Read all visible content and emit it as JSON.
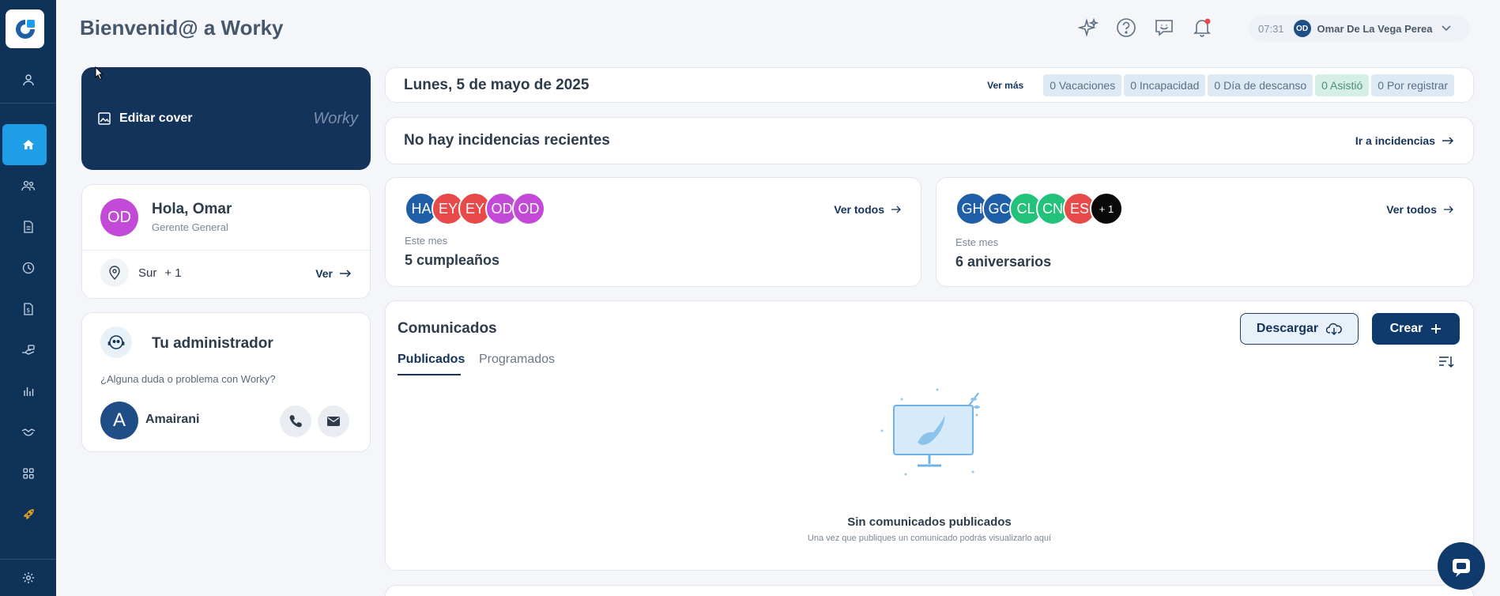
{
  "header": {
    "title": "Bienvenid@ a Worky",
    "time": "07:31",
    "user_initials": "OD",
    "user_name": "Omar De La Vega Perea"
  },
  "cover": {
    "edit_label": "Editar cover",
    "brand": "Worky"
  },
  "profile": {
    "initials": "OD",
    "greeting": "Hola, Omar",
    "role": "Gerente General",
    "location": "Sur",
    "location_extra": "+ 1",
    "view_label": "Ver"
  },
  "admin": {
    "title": "Tu administrador",
    "question": "¿Alguna duda o problema con Worky?",
    "initial": "A",
    "name": "Amairani"
  },
  "date_bar": {
    "date": "Lunes, 5 de mayo de 2025",
    "see_more": "Ver más",
    "chips": [
      "0 Vacaciones",
      "0 Incapacidad",
      "0 Día de descanso",
      "0 Asistió",
      "0 Por registrar"
    ]
  },
  "incidents": {
    "text": "No hay incidencias recientes",
    "link": "Ir a incidencias"
  },
  "birthdays": {
    "avatars": [
      {
        "initials": "HA",
        "color": "#1f5fa8"
      },
      {
        "initials": "EY",
        "color": "#e84a4a"
      },
      {
        "initials": "EY",
        "color": "#e84a4a"
      },
      {
        "initials": "OD",
        "color": "#c24ad6"
      },
      {
        "initials": "OD",
        "color": "#c24ad6"
      }
    ],
    "see_all": "Ver todos",
    "period": "Este mes",
    "count_label": "5 cumpleaños"
  },
  "anniversaries": {
    "avatars": [
      {
        "initials": "GH",
        "color": "#1f5fa8"
      },
      {
        "initials": "GC",
        "color": "#1f5fa8"
      },
      {
        "initials": "CL",
        "color": "#22c27a"
      },
      {
        "initials": "CN",
        "color": "#22c27a"
      },
      {
        "initials": "ES",
        "color": "#e84a4a"
      },
      {
        "initials": "+ 1",
        "color": "#0a0a0a"
      }
    ],
    "see_all": "Ver todos",
    "period": "Este mes",
    "count_label": "6 aniversarios"
  },
  "announcements": {
    "title": "Comunicados",
    "download_label": "Descargar",
    "create_label": "Crear",
    "tabs": [
      "Publicados",
      "Programados"
    ],
    "empty_title": "Sin comunicados publicados",
    "empty_subtitle": "Una vez que publiques un comunicado podrás visualizarlo aquí"
  },
  "colors": {
    "sidebar": "#0f3259",
    "active": "#1e9ee6",
    "primary": "#0f3b6c"
  }
}
